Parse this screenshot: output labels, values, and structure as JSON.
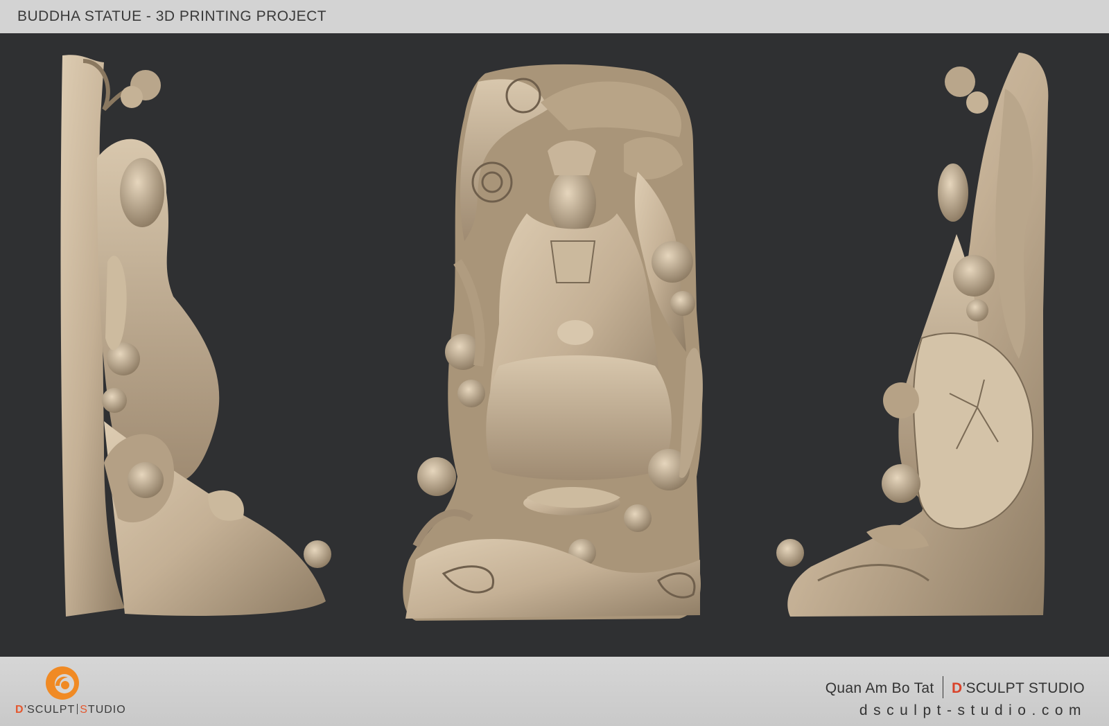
{
  "header": {
    "title": "BUDDHA STATUE - 3D PRINTING PROJECT"
  },
  "views": [
    {
      "name": "left-side-view"
    },
    {
      "name": "front-view"
    },
    {
      "name": "right-side-view"
    }
  ],
  "footer": {
    "logo": {
      "brand_d": "D",
      "brand_rest": "’SCULPT",
      "brand_s": "S",
      "brand_tail": "TUDIO"
    },
    "statue_name": "Quan Am Bo Tat",
    "studio_d": "D",
    "studio_rest": "’SCULPT STUDIO",
    "website": "dsculpt-studio.com"
  },
  "colors": {
    "background": "#2f3032",
    "sculpt": "#c8b59a",
    "accent": "#e4572e"
  }
}
